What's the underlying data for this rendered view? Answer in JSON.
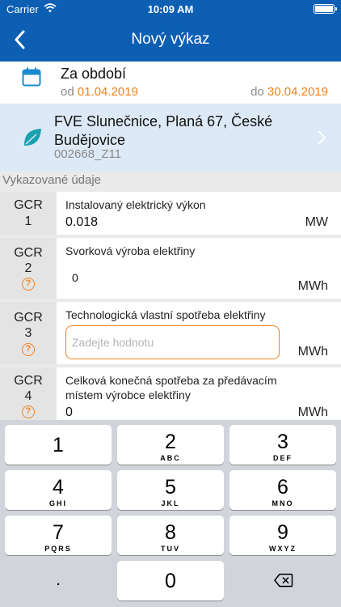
{
  "status": {
    "carrier": "Carrier",
    "time": "10:09 AM"
  },
  "nav": {
    "title": "Nový výkaz"
  },
  "period": {
    "label": "Za období",
    "from_prefix": "od",
    "from_date": "01.04.2019",
    "to_prefix": "do",
    "to_date": "30.04.2019"
  },
  "plant": {
    "name": "FVE Slunečnice, Planá 67, České Budějovice",
    "code": "002668_Z11"
  },
  "section": {
    "title": "Vykazované údaje"
  },
  "rows": [
    {
      "code_top": "GCR",
      "code_bottom": "1",
      "description": "Instalovaný elektrický výkon",
      "value": "0.018",
      "unit": "MW"
    },
    {
      "code_top": "GCR",
      "code_bottom": "2",
      "help": "?",
      "description": "Svorková výroba elektřiny",
      "value": "0",
      "unit": "MWh"
    },
    {
      "code_top": "GCR",
      "code_bottom": "3",
      "help": "?",
      "description": "Technologická vlastní spotřeba elektřiny",
      "placeholder": "Zadejte hodnotu",
      "unit": "MWh"
    },
    {
      "code_top": "GCR",
      "code_bottom": "4",
      "help": "?",
      "description": "Celková konečná spotřeba za předávacím místem výrobce elektřiny",
      "value": "0",
      "unit": "MWh"
    }
  ],
  "keyboard": {
    "keys": [
      {
        "num": "1",
        "letters": ""
      },
      {
        "num": "2",
        "letters": "ABC"
      },
      {
        "num": "3",
        "letters": "DEF"
      },
      {
        "num": "4",
        "letters": "GHI"
      },
      {
        "num": "5",
        "letters": "JKL"
      },
      {
        "num": "6",
        "letters": "MNO"
      },
      {
        "num": "7",
        "letters": "PQRS"
      },
      {
        "num": "8",
        "letters": "TUV"
      },
      {
        "num": "9",
        "letters": "WXYZ"
      },
      {
        "num": ".",
        "letters": ""
      },
      {
        "num": "0",
        "letters": ""
      }
    ]
  },
  "colors": {
    "primary": "#0d5fb4",
    "accent": "#f0821e",
    "plant_bg": "#dde9f6"
  },
  "icons": {
    "calendar": "calendar-icon",
    "leaf": "leaf-icon",
    "back": "back-chevron-icon",
    "chevron": "chevron-right-icon",
    "help": "help-circle-icon",
    "backspace": "backspace-icon"
  }
}
